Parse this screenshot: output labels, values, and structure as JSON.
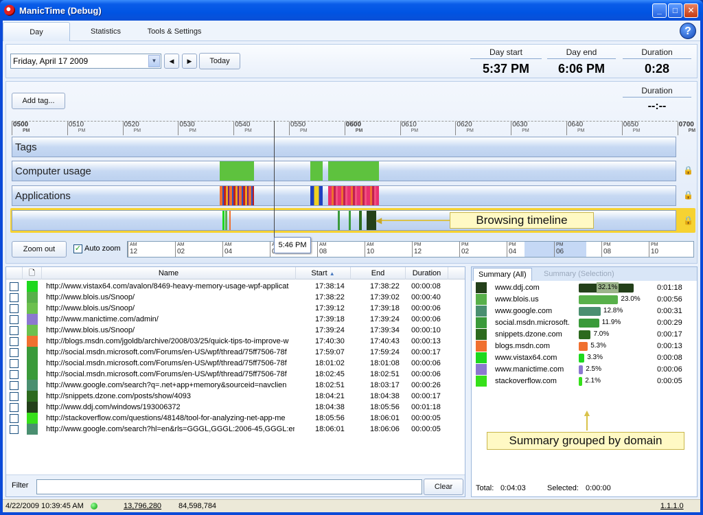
{
  "window": {
    "title": "ManicTime (Debug)"
  },
  "tabs": [
    "Day",
    "Statistics",
    "Tools & Settings"
  ],
  "date": {
    "selected": "Friday, April 17 2009",
    "today_label": "Today"
  },
  "summary_stats": {
    "day_start_label": "Day start",
    "day_start": "5:37 PM",
    "day_end_label": "Day end",
    "day_end": "6:06 PM",
    "duration_label": "Duration",
    "duration": "0:28",
    "sel_duration_label": "Duration",
    "sel_duration": "--:--"
  },
  "timeline": {
    "add_tag_label": "Add tag...",
    "ruler_ticks": [
      {
        "h": "05",
        "m": "00",
        "ap": "PM"
      },
      {
        "h": "05",
        "m": "10",
        "ap": "PM"
      },
      {
        "h": "05",
        "m": "20",
        "ap": "PM"
      },
      {
        "h": "05",
        "m": "30",
        "ap": "PM"
      },
      {
        "h": "05",
        "m": "40",
        "ap": "PM"
      },
      {
        "h": "05",
        "m": "50",
        "ap": "PM"
      },
      {
        "h": "06",
        "m": "00",
        "ap": "PM"
      },
      {
        "h": "06",
        "m": "10",
        "ap": "PM"
      },
      {
        "h": "06",
        "m": "20",
        "ap": "PM"
      },
      {
        "h": "06",
        "m": "30",
        "ap": "PM"
      },
      {
        "h": "06",
        "m": "40",
        "ap": "PM"
      },
      {
        "h": "06",
        "m": "50",
        "ap": "PM"
      },
      {
        "h": "07",
        "m": "00",
        "ap": "PM"
      }
    ],
    "tracks": [
      "Tags",
      "Computer usage",
      "Applications",
      ""
    ],
    "browsing_callout": "Browsing timeline",
    "zoom_out_label": "Zoom out",
    "auto_zoom_label": "Auto zoom",
    "cursor_time": "5:46 PM",
    "minibar_ticks": [
      {
        "ap": "AM",
        "h": "12"
      },
      {
        "ap": "AM",
        "h": "02"
      },
      {
        "ap": "AM",
        "h": "04"
      },
      {
        "ap": "AM",
        "h": "06"
      },
      {
        "ap": "AM",
        "h": "08"
      },
      {
        "ap": "AM",
        "h": "10"
      },
      {
        "ap": "PM",
        "h": "12"
      },
      {
        "ap": "PM",
        "h": "02"
      },
      {
        "ap": "PM",
        "h": "04"
      },
      {
        "ap": "PM",
        "h": "06"
      },
      {
        "ap": "PM",
        "h": "08"
      },
      {
        "ap": "PM",
        "h": "10"
      }
    ]
  },
  "list": {
    "headers": [
      "Name",
      "Start",
      "End",
      "Duration"
    ],
    "rows": [
      {
        "color": "#1ed81e",
        "url": "http://www.vistax64.com/avalon/8469-heavy-memory-usage-wpf-applicat",
        "start": "17:38:14",
        "end": "17:38:22",
        "dur": "00:00:08"
      },
      {
        "color": "#58b04a",
        "url": "http://www.blois.us/Snoop/",
        "start": "17:38:22",
        "end": "17:39:02",
        "dur": "00:00:40"
      },
      {
        "color": "#6cc04e",
        "url": "http://www.blois.us/Snoop/",
        "start": "17:39:12",
        "end": "17:39:18",
        "dur": "00:00:06"
      },
      {
        "color": "#8c78d0",
        "url": "http://www.manictime.com/admin/",
        "start": "17:39:18",
        "end": "17:39:24",
        "dur": "00:00:06"
      },
      {
        "color": "#6cc04e",
        "url": "http://www.blois.us/Snoop/",
        "start": "17:39:24",
        "end": "17:39:34",
        "dur": "00:00:10"
      },
      {
        "color": "#f07030",
        "url": "http://blogs.msdn.com/jgoldb/archive/2008/03/25/quick-tips-to-improve-w",
        "start": "17:40:30",
        "end": "17:40:43",
        "dur": "00:00:13"
      },
      {
        "color": "#3a9a3a",
        "url": "http://social.msdn.microsoft.com/Forums/en-US/wpf/thread/75ff7506-78f",
        "start": "17:59:07",
        "end": "17:59:24",
        "dur": "00:00:17"
      },
      {
        "color": "#3a9a3a",
        "url": "http://social.msdn.microsoft.com/Forums/en-US/wpf/thread/75ff7506-78f",
        "start": "18:01:02",
        "end": "18:01:08",
        "dur": "00:00:06"
      },
      {
        "color": "#3a9a3a",
        "url": "http://social.msdn.microsoft.com/Forums/en-US/wpf/thread/75ff7506-78f",
        "start": "18:02:45",
        "end": "18:02:51",
        "dur": "00:00:06"
      },
      {
        "color": "#4a8f70",
        "url": "http://www.google.com/search?q=.net+app+memory&sourceid=navclien",
        "start": "18:02:51",
        "end": "18:03:17",
        "dur": "00:00:26"
      },
      {
        "color": "#2c6a1e",
        "url": "http://snippets.dzone.com/posts/show/4093",
        "start": "18:04:21",
        "end": "18:04:38",
        "dur": "00:00:17"
      },
      {
        "color": "#24401a",
        "url": "http://www.ddj.com/windows/193006372",
        "start": "18:04:38",
        "end": "18:05:56",
        "dur": "00:01:18"
      },
      {
        "color": "#36e01a",
        "url": "http://stackoverflow.com/questions/48148/tool-for-analyzing-net-app-me",
        "start": "18:05:56",
        "end": "18:06:01",
        "dur": "00:00:05"
      },
      {
        "color": "#4a8f70",
        "url": "http://www.google.com/search?hl=en&rls=GGGL,GGGL:2006-45,GGGL:en",
        "start": "18:06:01",
        "end": "18:06:06",
        "dur": "00:00:05"
      }
    ],
    "filter_label": "Filter",
    "filter_value": "",
    "clear_label": "Clear"
  },
  "summary": {
    "tab_all": "Summary (All)",
    "tab_sel": "Summary (Selection)",
    "rows": [
      {
        "color": "#24401a",
        "domain": "www.ddj.com",
        "pct": 32.1,
        "pct_label": "32.1%",
        "dur": "0:01:18"
      },
      {
        "color": "#58b04a",
        "domain": "www.blois.us",
        "pct": 23.0,
        "pct_label": "23.0%",
        "dur": "0:00:56"
      },
      {
        "color": "#4a8f70",
        "domain": "www.google.com",
        "pct": 12.8,
        "pct_label": "12.8%",
        "dur": "0:00:31"
      },
      {
        "color": "#3a9a3a",
        "domain": "social.msdn.microsoft.",
        "pct": 11.9,
        "pct_label": "11.9%",
        "dur": "0:00:29"
      },
      {
        "color": "#2c6a1e",
        "domain": "snippets.dzone.com",
        "pct": 7.0,
        "pct_label": "7.0%",
        "dur": "0:00:17"
      },
      {
        "color": "#f07030",
        "domain": "blogs.msdn.com",
        "pct": 5.3,
        "pct_label": "5.3%",
        "dur": "0:00:13"
      },
      {
        "color": "#1ed81e",
        "domain": "www.vistax64.com",
        "pct": 3.3,
        "pct_label": "3.3%",
        "dur": "0:00:08"
      },
      {
        "color": "#8c78d0",
        "domain": "www.manictime.com",
        "pct": 2.5,
        "pct_label": "2.5%",
        "dur": "0:00:06"
      },
      {
        "color": "#36e01a",
        "domain": "stackoverflow.com",
        "pct": 2.1,
        "pct_label": "2.1%",
        "dur": "0:00:05"
      }
    ],
    "callout": "Summary grouped by domain",
    "total_label": "Total:",
    "total": "0:04:03",
    "selected_label": "Selected:",
    "selected": "0:00:00"
  },
  "status": {
    "datetime": "4/22/2009 10:39:45 AM",
    "mem1": "13,796,280",
    "mem2": "84,598,784",
    "version": "1.1.1.0"
  }
}
